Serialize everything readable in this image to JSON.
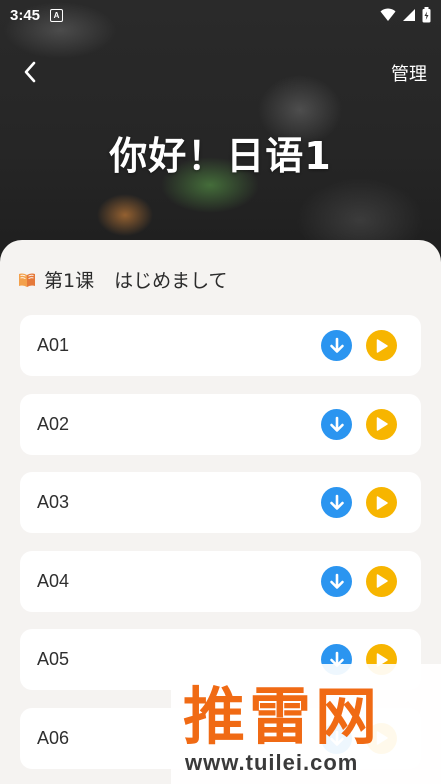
{
  "status": {
    "time": "3:45",
    "notification_icon": "A"
  },
  "header": {
    "title": "你好！日语1",
    "manage_label": "管理"
  },
  "lesson": {
    "number": "第1课",
    "subtitle": "はじめまして"
  },
  "tracks": [
    {
      "label": "A01"
    },
    {
      "label": "A02"
    },
    {
      "label": "A03"
    },
    {
      "label": "A04"
    },
    {
      "label": "A05"
    },
    {
      "label": "A06"
    }
  ],
  "watermark": {
    "logo": "推雷网",
    "url": "www.tuilei.com"
  },
  "colors": {
    "download": "#2b95f0",
    "play": "#f7b500",
    "sheet_bg": "#f5f3f1"
  },
  "icons": [
    "back-chevron-icon",
    "book-icon",
    "download-icon",
    "play-icon",
    "wifi-icon",
    "signal-icon",
    "battery-icon"
  ]
}
